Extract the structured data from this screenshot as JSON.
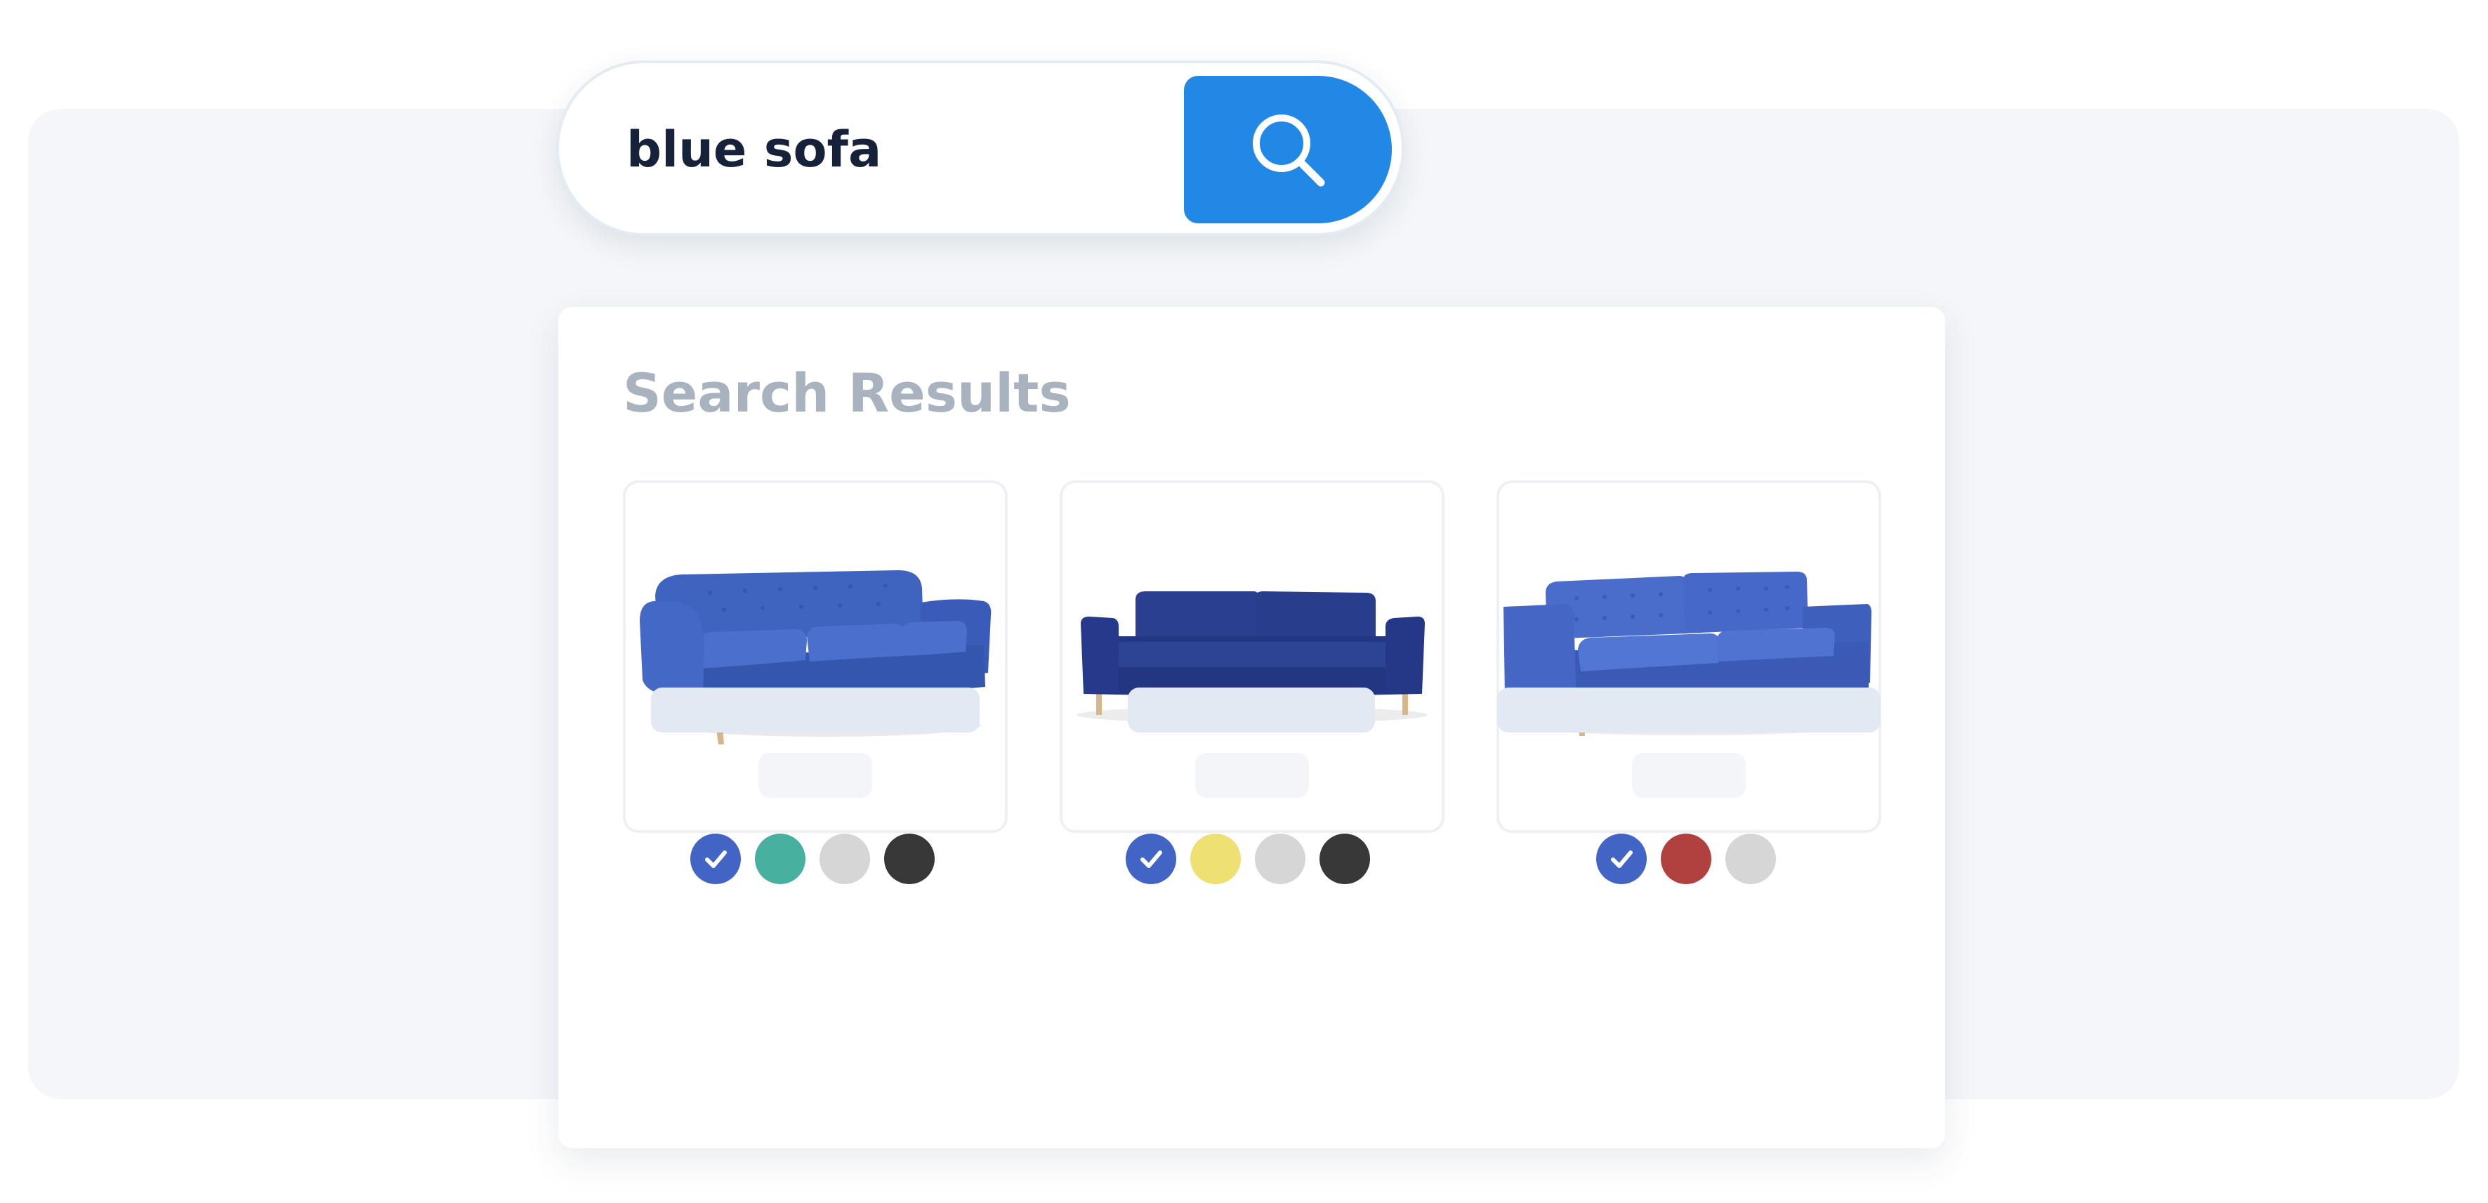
{
  "search": {
    "query": "blue sofa",
    "button_icon": "search-icon",
    "button_color": "#2288e6"
  },
  "results": {
    "title": "Search Results",
    "products": [
      {
        "image": "blue-mid-century-tufted-sofa",
        "swatches": [
          {
            "color": "#4264c4",
            "selected": true
          },
          {
            "color": "#48b09f",
            "selected": false
          },
          {
            "color": "#d6d6d6",
            "selected": false
          },
          {
            "color": "#383838",
            "selected": false
          }
        ]
      },
      {
        "image": "navy-modern-sofa",
        "swatches": [
          {
            "color": "#4264c4",
            "selected": true
          },
          {
            "color": "#efe073",
            "selected": false
          },
          {
            "color": "#d6d6d6",
            "selected": false
          },
          {
            "color": "#383838",
            "selected": false
          }
        ]
      },
      {
        "image": "blue-tufted-back-sofa",
        "swatches": [
          {
            "color": "#4264c4",
            "selected": true
          },
          {
            "color": "#b0413e",
            "selected": false
          },
          {
            "color": "#d6d6d6",
            "selected": false
          }
        ]
      }
    ]
  },
  "colors": {
    "accent": "#2288e6",
    "backdrop": "#f4f6f9",
    "title_gray": "#a9b3c0",
    "skeleton": "#e2e9f2"
  }
}
